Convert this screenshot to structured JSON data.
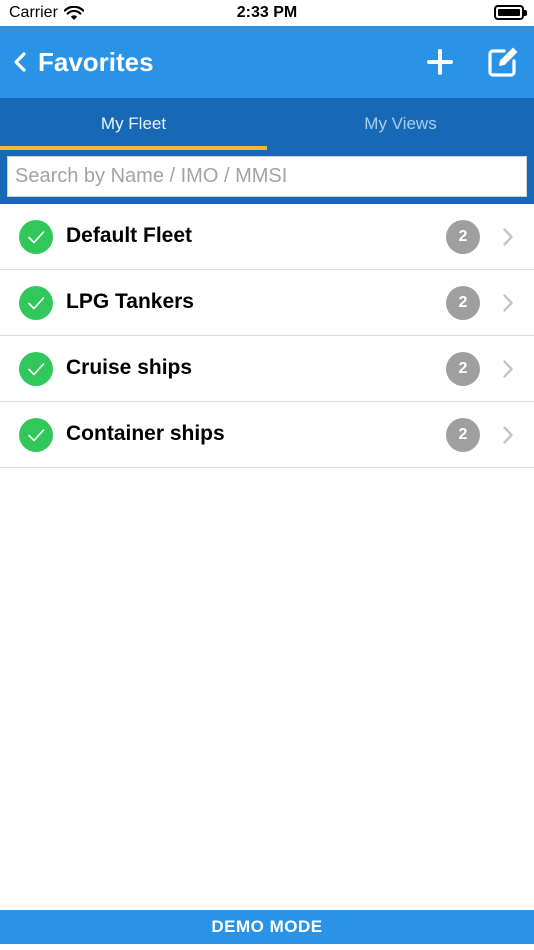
{
  "status_bar": {
    "carrier": "Carrier",
    "time": "2:33 PM"
  },
  "nav": {
    "title": "Favorites",
    "back_icon": "chevron-left-icon",
    "add_icon": "plus-icon",
    "edit_icon": "compose-icon"
  },
  "tabs": [
    {
      "label": "My Fleet",
      "active": true
    },
    {
      "label": "My Views",
      "active": false
    }
  ],
  "search": {
    "placeholder": "Search by Name / IMO / MMSI",
    "value": ""
  },
  "fleets": [
    {
      "name": "Default Fleet",
      "count": "2",
      "selected": true
    },
    {
      "name": "LPG Tankers",
      "count": "2",
      "selected": true
    },
    {
      "name": "Cruise ships",
      "count": "2",
      "selected": true
    },
    {
      "name": "Container ships",
      "count": "2",
      "selected": true
    }
  ],
  "footer": {
    "label": "DEMO MODE"
  },
  "colors": {
    "nav_blue": "#2a93e6",
    "tab_blue": "#1769b6",
    "tab_indicator": "#f3b634",
    "check_green": "#31c75a",
    "badge_gray": "#9f9f9f"
  }
}
